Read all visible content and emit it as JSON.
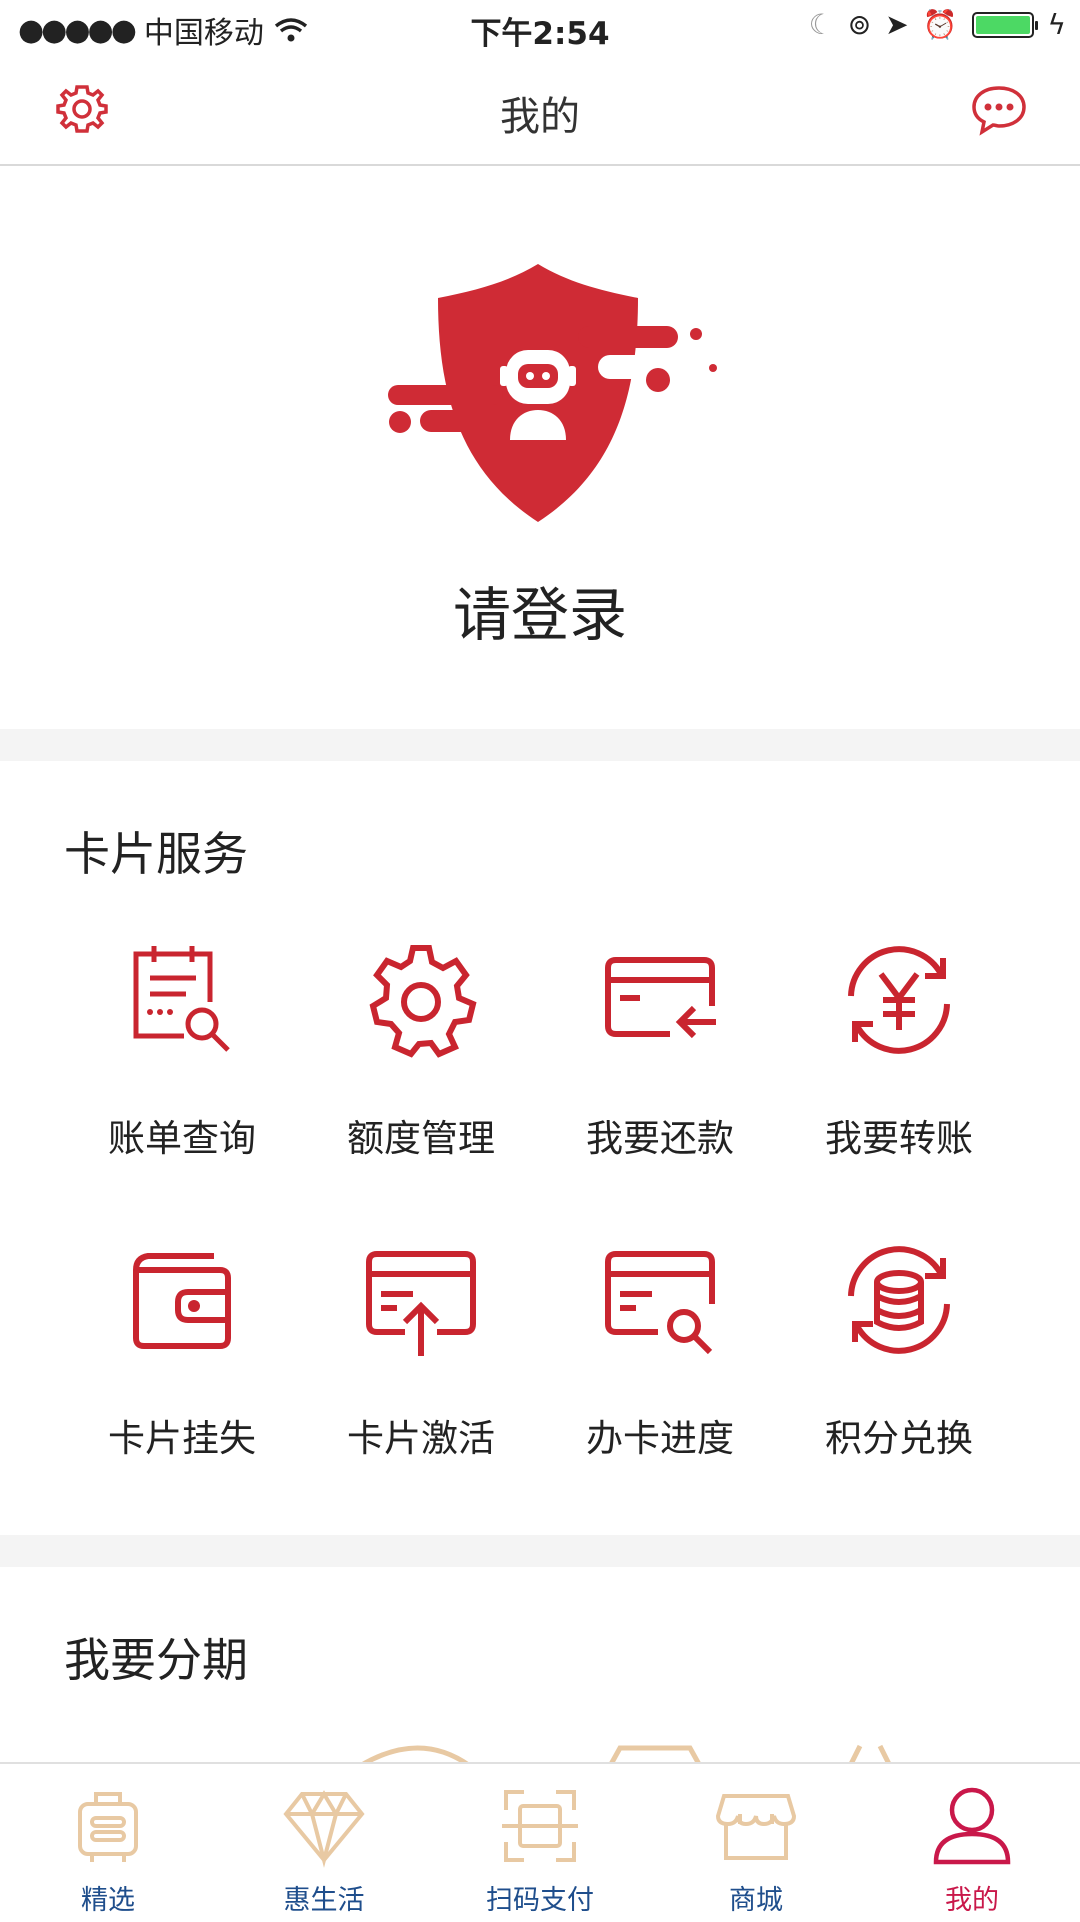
{
  "status_bar": {
    "carrier": "中国移动",
    "time": "下午2:54"
  },
  "nav": {
    "title": "我的"
  },
  "profile": {
    "login_text": "请登录"
  },
  "card_services": {
    "title": "卡片服务",
    "items": [
      {
        "label": "账单查询",
        "icon": "bill-search-icon"
      },
      {
        "label": "额度管理",
        "icon": "gear-icon"
      },
      {
        "label": "我要还款",
        "icon": "card-repay-icon"
      },
      {
        "label": "我要转账",
        "icon": "yen-transfer-icon"
      },
      {
        "label": "卡片挂失",
        "icon": "wallet-lock-icon"
      },
      {
        "label": "卡片激活",
        "icon": "card-activate-icon"
      },
      {
        "label": "办卡进度",
        "icon": "card-progress-icon"
      },
      {
        "label": "积分兑换",
        "icon": "coins-exchange-icon"
      }
    ]
  },
  "installment": {
    "title": "我要分期"
  },
  "tabbar": {
    "items": [
      {
        "label": "精选",
        "icon": "bag-icon",
        "active": false
      },
      {
        "label": "惠生活",
        "icon": "diamond-icon",
        "active": false
      },
      {
        "label": "扫码支付",
        "icon": "scan-icon",
        "active": false
      },
      {
        "label": "商城",
        "icon": "shop-icon",
        "active": false
      },
      {
        "label": "我的",
        "icon": "user-icon",
        "active": true
      }
    ]
  },
  "colors": {
    "accent": "#c9252f",
    "tab_inactive": "#1f4e8c",
    "tab_active": "#c9184a",
    "tab_icon": "#e8c9a3"
  }
}
